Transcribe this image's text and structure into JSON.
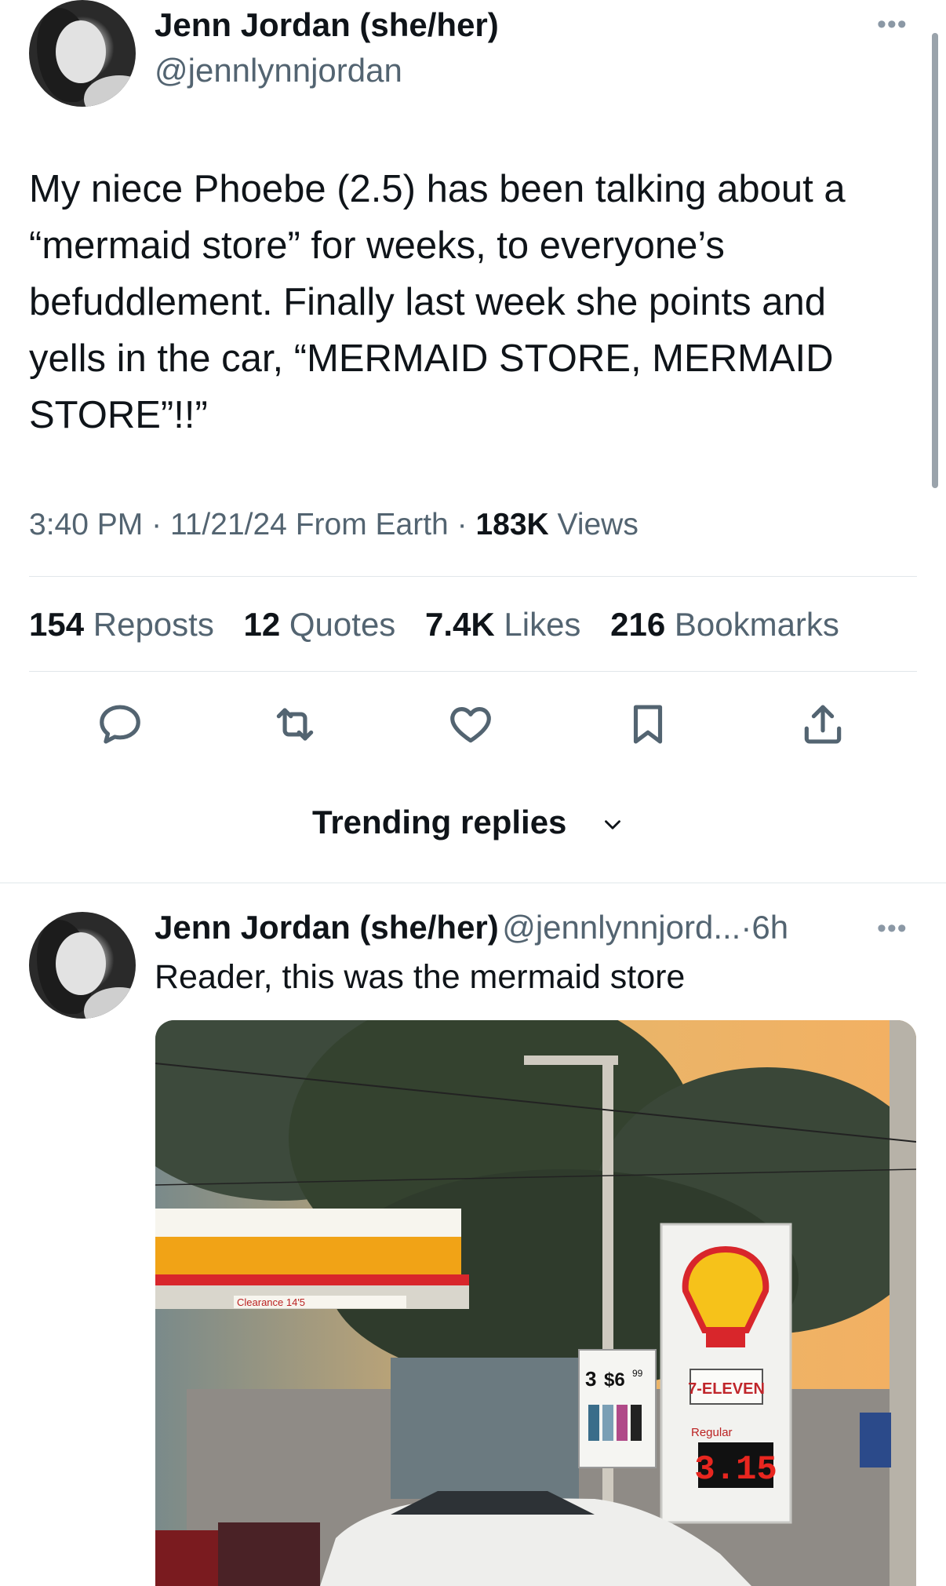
{
  "tweet": {
    "author_name": "Jenn Jordan (she/her)",
    "author_handle": "@jennlynnjordan",
    "more_icon": "more-horizontal-icon",
    "text_lines": [
      "My niece Phoebe (2.5) has been talking about a",
      "“mermaid store” for weeks, to everyone’s",
      "befuddlement. Finally last week she points and",
      "yells in the car, “MERMAID STORE, MERMAID",
      "STORE”!!”"
    ],
    "time": "3:40 PM",
    "date": "11/21/24",
    "source": "From Earth",
    "views_count": "183K",
    "views_label": "Views",
    "separator": "·"
  },
  "stats": {
    "reposts_count": "154",
    "reposts_label": "Reposts",
    "quotes_count": "12",
    "quotes_label": "Quotes",
    "likes_count": "7.4K",
    "likes_label": "Likes",
    "bookmarks_count": "216",
    "bookmarks_label": "Bookmarks"
  },
  "actions": [
    "reply-icon",
    "repost-icon",
    "like-icon",
    "bookmark-icon",
    "share-icon"
  ],
  "replies_sort": {
    "label": "Trending replies",
    "icon": "chevron-down-icon"
  },
  "reply": {
    "author_name": "Jenn Jordan (she/her)",
    "author_handle": "@jennlynnjord...",
    "separator": "·",
    "age": "6h",
    "text": "Reader, this was the mermaid store",
    "image_signs": {
      "canopy_label": "Clearance 14'5",
      "store_brand": "7-ELEVEN",
      "fuel_grade": "Regular",
      "fuel_price": "3.15",
      "promo_price_left": "3",
      "promo_price_right": "$6",
      "promo_cents": "99"
    }
  },
  "colors": {
    "text": "#0f1419",
    "secondary": "#536471",
    "divider": "#e1e6ea",
    "shell_yellow": "#f6c21a",
    "shell_red": "#d8262b"
  }
}
